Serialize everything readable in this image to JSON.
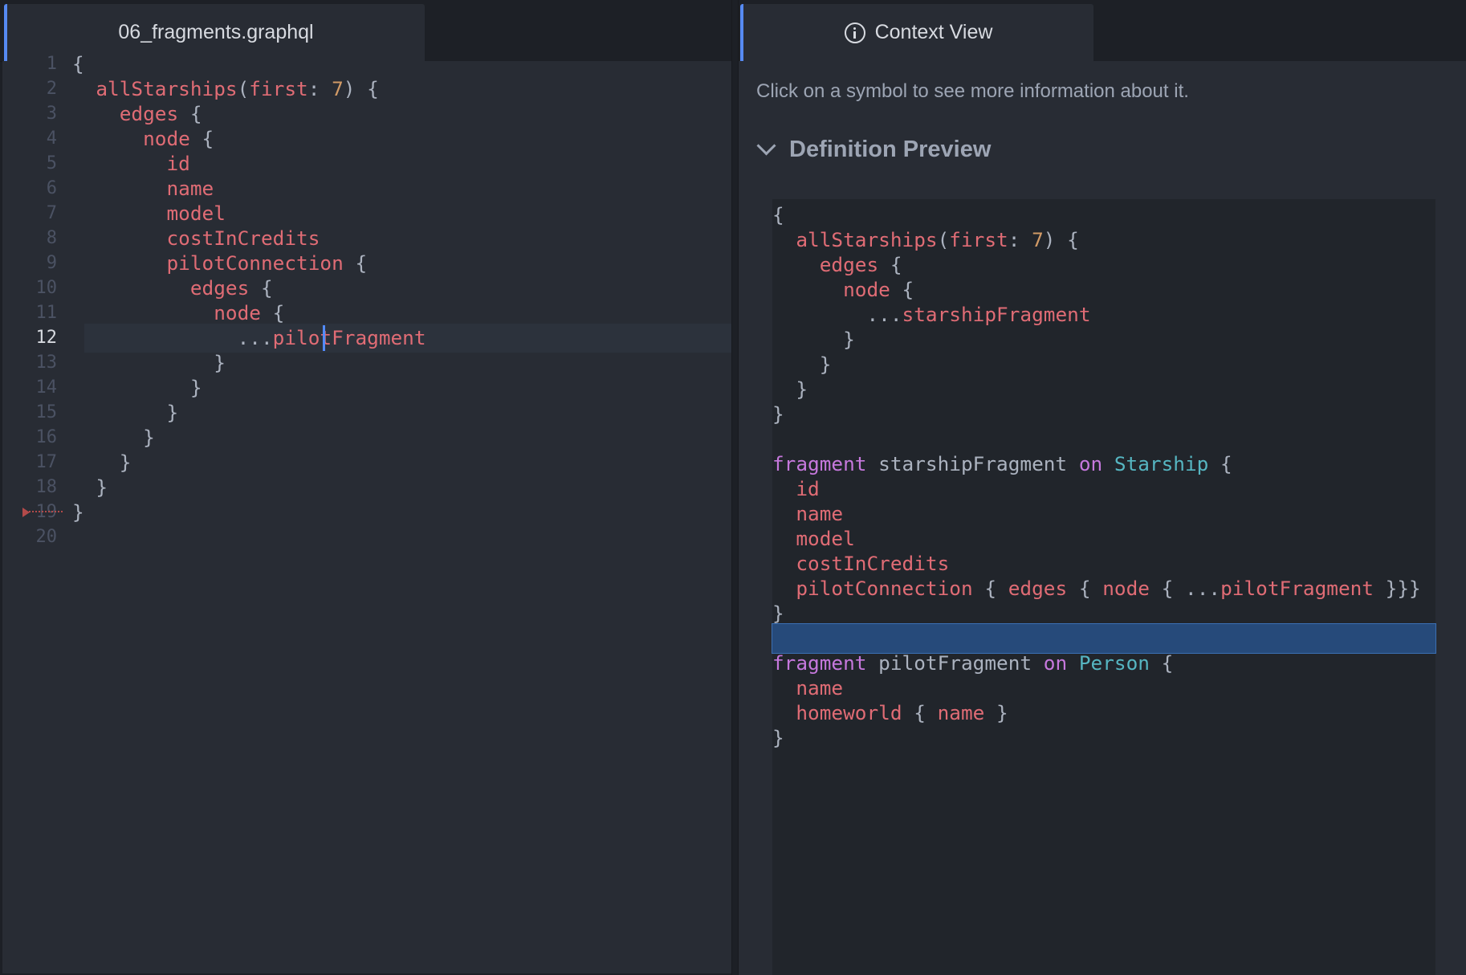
{
  "editor": {
    "tab_title": "06_fragments.graphql",
    "active_line": 12,
    "lines": [
      [
        {
          "t": "{",
          "c": "punct"
        }
      ],
      [
        {
          "t": "  "
        },
        {
          "t": "allStarships",
          "c": "field"
        },
        {
          "t": "(",
          "c": "punct"
        },
        {
          "t": "first",
          "c": "field"
        },
        {
          "t": ": ",
          "c": "punct"
        },
        {
          "t": "7",
          "c": "num"
        },
        {
          "t": ") {",
          "c": "punct"
        }
      ],
      [
        {
          "t": "    "
        },
        {
          "t": "edges",
          "c": "field"
        },
        {
          "t": " {",
          "c": "punct"
        }
      ],
      [
        {
          "t": "      "
        },
        {
          "t": "node",
          "c": "field"
        },
        {
          "t": " {",
          "c": "punct"
        }
      ],
      [
        {
          "t": "        "
        },
        {
          "t": "id",
          "c": "field"
        }
      ],
      [
        {
          "t": "        "
        },
        {
          "t": "name",
          "c": "field"
        }
      ],
      [
        {
          "t": "        "
        },
        {
          "t": "model",
          "c": "field"
        }
      ],
      [
        {
          "t": "        "
        },
        {
          "t": "costInCredits",
          "c": "field"
        }
      ],
      [
        {
          "t": "        "
        },
        {
          "t": "pilotConnection",
          "c": "field"
        },
        {
          "t": " {",
          "c": "punct"
        }
      ],
      [
        {
          "t": "          "
        },
        {
          "t": "edges",
          "c": "field"
        },
        {
          "t": " {",
          "c": "punct"
        }
      ],
      [
        {
          "t": "            "
        },
        {
          "t": "node",
          "c": "field"
        },
        {
          "t": " {",
          "c": "punct"
        }
      ],
      [
        {
          "t": "              "
        },
        {
          "t": "...",
          "c": "spread"
        },
        {
          "t": "pilotFragment",
          "c": "field"
        }
      ],
      [
        {
          "t": "            "
        },
        {
          "t": "}",
          "c": "punct"
        }
      ],
      [
        {
          "t": "          "
        },
        {
          "t": "}",
          "c": "punct"
        }
      ],
      [
        {
          "t": "        "
        },
        {
          "t": "}",
          "c": "punct"
        }
      ],
      [
        {
          "t": "      "
        },
        {
          "t": "}",
          "c": "punct"
        }
      ],
      [
        {
          "t": "    "
        },
        {
          "t": "}",
          "c": "punct"
        }
      ],
      [
        {
          "t": "  "
        },
        {
          "t": "}",
          "c": "punct"
        }
      ],
      [
        {
          "t": "}",
          "c": "punct"
        }
      ],
      []
    ]
  },
  "context_view": {
    "tab_title": "Context View",
    "tab_icon": "info-icon",
    "hint": "Click on a symbol to see more information about it.",
    "section_title": "Definition Preview",
    "section_icon": "chevron-down-icon",
    "highlight_line": 18,
    "preview_lines": [
      [
        {
          "t": "{",
          "c": "punct"
        }
      ],
      [
        {
          "t": "  "
        },
        {
          "t": "allStarships",
          "c": "field"
        },
        {
          "t": "(",
          "c": "punct"
        },
        {
          "t": "first",
          "c": "field"
        },
        {
          "t": ": ",
          "c": "punct"
        },
        {
          "t": "7",
          "c": "num"
        },
        {
          "t": ") {",
          "c": "punct"
        }
      ],
      [
        {
          "t": "    "
        },
        {
          "t": "edges",
          "c": "field"
        },
        {
          "t": " {",
          "c": "punct"
        }
      ],
      [
        {
          "t": "      "
        },
        {
          "t": "node",
          "c": "field"
        },
        {
          "t": " {",
          "c": "punct"
        }
      ],
      [
        {
          "t": "        "
        },
        {
          "t": "...",
          "c": "spread"
        },
        {
          "t": "starshipFragment",
          "c": "field"
        }
      ],
      [
        {
          "t": "      "
        },
        {
          "t": "}",
          "c": "punct"
        }
      ],
      [
        {
          "t": "    "
        },
        {
          "t": "}",
          "c": "punct"
        }
      ],
      [
        {
          "t": "  "
        },
        {
          "t": "}",
          "c": "punct"
        }
      ],
      [
        {
          "t": "}",
          "c": "punct"
        }
      ],
      [],
      [
        {
          "t": "fragment",
          "c": "kw"
        },
        {
          "t": " starshipFragment ",
          "c": "name"
        },
        {
          "t": "on",
          "c": "kw"
        },
        {
          "t": " "
        },
        {
          "t": "Starship",
          "c": "type"
        },
        {
          "t": " {",
          "c": "punct"
        }
      ],
      [
        {
          "t": "  "
        },
        {
          "t": "id",
          "c": "field"
        }
      ],
      [
        {
          "t": "  "
        },
        {
          "t": "name",
          "c": "field"
        }
      ],
      [
        {
          "t": "  "
        },
        {
          "t": "model",
          "c": "field"
        }
      ],
      [
        {
          "t": "  "
        },
        {
          "t": "costInCredits",
          "c": "field"
        }
      ],
      [
        {
          "t": "  "
        },
        {
          "t": "pilotConnection",
          "c": "field"
        },
        {
          "t": " { ",
          "c": "punct"
        },
        {
          "t": "edges",
          "c": "field"
        },
        {
          "t": " { ",
          "c": "punct"
        },
        {
          "t": "node",
          "c": "field"
        },
        {
          "t": " { ",
          "c": "punct"
        },
        {
          "t": "...",
          "c": "spread"
        },
        {
          "t": "pilotFragment",
          "c": "field"
        },
        {
          "t": " }}}",
          "c": "punct"
        }
      ],
      [
        {
          "t": "}",
          "c": "punct"
        }
      ],
      [],
      [
        {
          "t": "fragment",
          "c": "kw"
        },
        {
          "t": " pilotFragment ",
          "c": "name"
        },
        {
          "t": "on",
          "c": "kw"
        },
        {
          "t": " "
        },
        {
          "t": "Person",
          "c": "type"
        },
        {
          "t": " {",
          "c": "punct"
        }
      ],
      [
        {
          "t": "  "
        },
        {
          "t": "name",
          "c": "field"
        }
      ],
      [
        {
          "t": "  "
        },
        {
          "t": "homeworld",
          "c": "field"
        },
        {
          "t": " { ",
          "c": "punct"
        },
        {
          "t": "name",
          "c": "field"
        },
        {
          "t": " }",
          "c": "punct"
        }
      ],
      [
        {
          "t": "}",
          "c": "punct"
        }
      ]
    ]
  },
  "colors": {
    "field": "#e06c75",
    "number": "#d19a66",
    "keyword": "#c678dd",
    "type": "#56b6c2",
    "punctuation": "#abb2bf",
    "accent": "#568af2",
    "highlight": "#264a7a"
  }
}
